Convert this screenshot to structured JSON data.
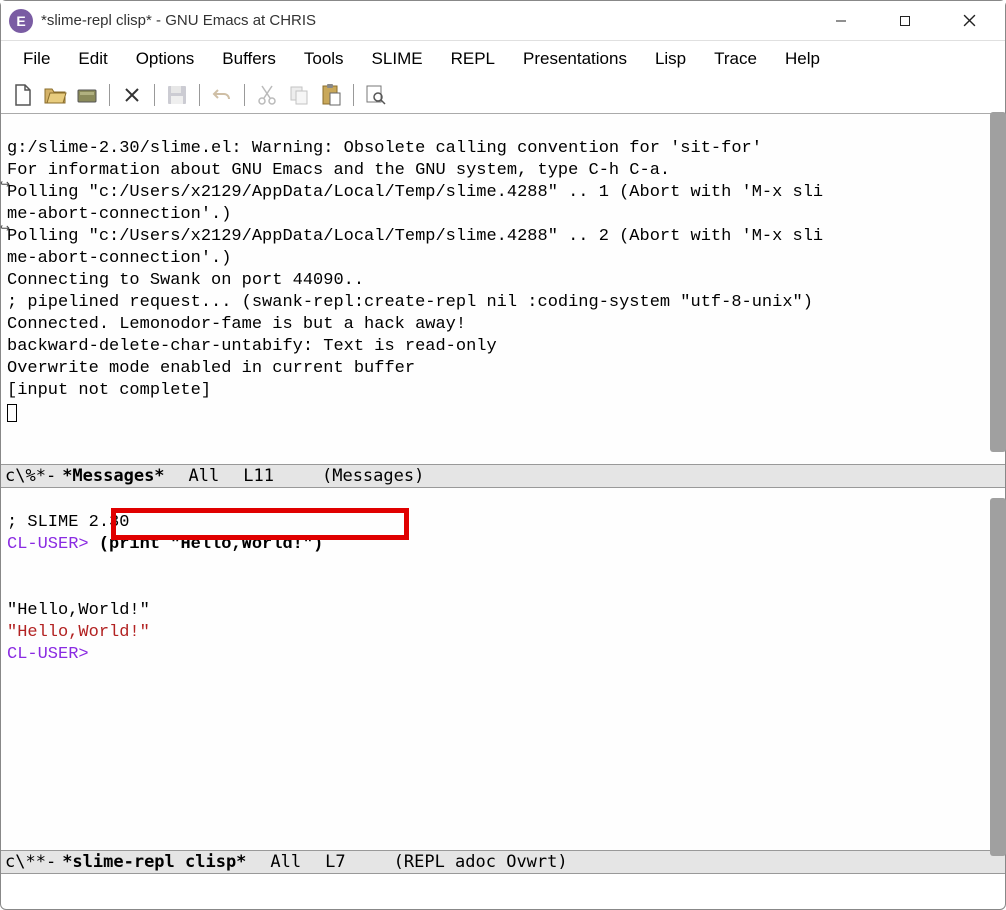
{
  "title": "*slime-repl clisp* - GNU Emacs at CHRIS",
  "menu": [
    "File",
    "Edit",
    "Options",
    "Buffers",
    "Tools",
    "SLIME",
    "REPL",
    "Presentations",
    "Lisp",
    "Trace",
    "Help"
  ],
  "toolbar_icons": [
    "new",
    "open",
    "folder",
    "close",
    "save",
    "undo",
    "cut",
    "copy",
    "paste",
    "find"
  ],
  "messages": {
    "lines": [
      "g:/slime-2.30/slime.el: Warning: Obsolete calling convention for 'sit-for'",
      "For information about GNU Emacs and the GNU system, type C-h C-a.",
      "Polling \"c:/Users/x2129/AppData/Local/Temp/slime.4288\" .. 1 (Abort with 'M-x sli",
      "me-abort-connection'.)",
      "Polling \"c:/Users/x2129/AppData/Local/Temp/slime.4288\" .. 2 (Abort with 'M-x sli",
      "me-abort-connection'.)",
      "Connecting to Swank on port 44090..",
      "; pipelined request... (swank-repl:create-repl nil :coding-system \"utf-8-unix\")",
      "Connected. Lemonodor-fame is but a hack away!",
      "backward-delete-char-untabify: Text is read-only",
      "Overwrite mode enabled in current buffer",
      "[input not complete]"
    ],
    "modeline": {
      "prefix": " c\\%*-",
      "name": "*Messages*",
      "pos": "All",
      "line": "L11",
      "mode": "(Messages)"
    }
  },
  "repl": {
    "header": "; SLIME 2.30",
    "prompt": "CL-USER>",
    "input": " (print \"Hello,World!\")",
    "out1": "\"Hello,World!\" ",
    "out2": "\"Hello,World!\"",
    "modeline": {
      "prefix": " c\\**-",
      "name": "*slime-repl clisp*",
      "pos": "All",
      "line": "L7",
      "mode": "(REPL adoc Ovwrt)"
    }
  }
}
